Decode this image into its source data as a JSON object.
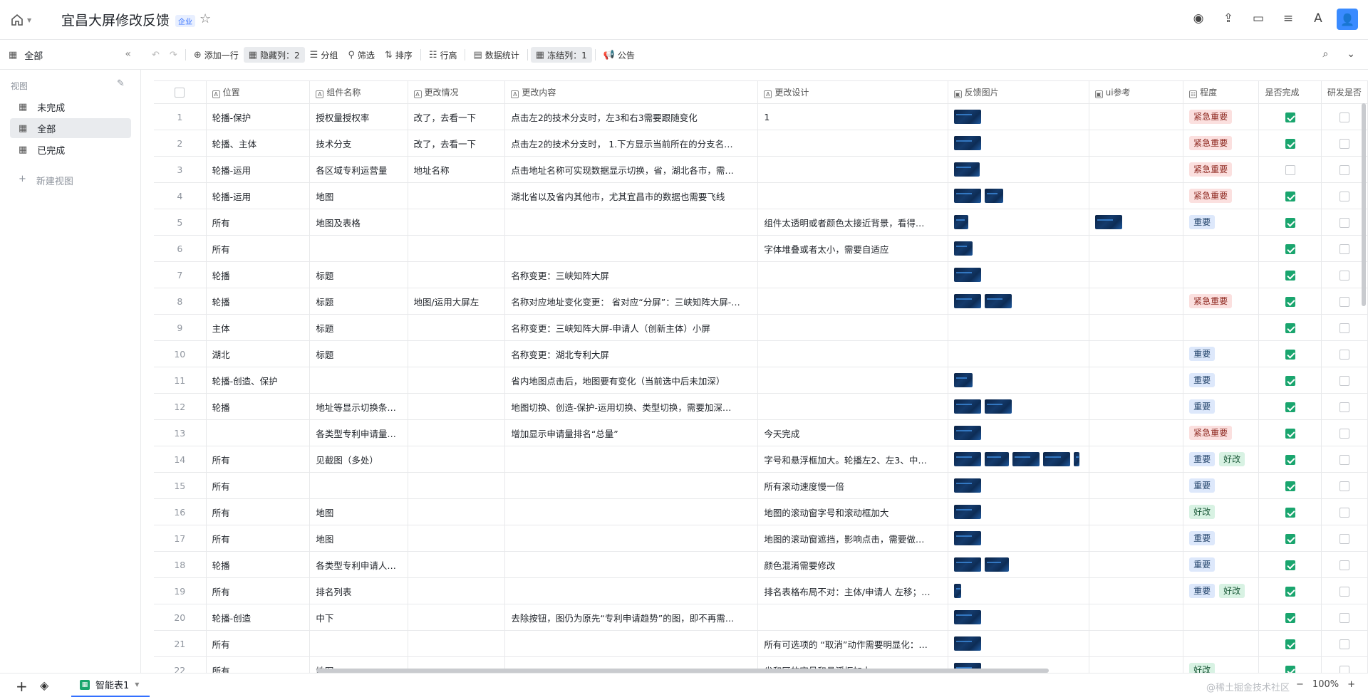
{
  "header": {
    "title": "宜昌大屏修改反馈",
    "badge": "企业"
  },
  "toolbar": {
    "view_name": "全部",
    "add_row": "添加一行",
    "hidden_cols": "隐藏列：2",
    "group": "分组",
    "filter": "筛选",
    "sort": "排序",
    "row_height": "行高",
    "stats": "数据统计",
    "frozen_cols": "冻结列：1",
    "notice": "公告"
  },
  "sidebar": {
    "heading": "视图",
    "items": [
      {
        "label": "未完成"
      },
      {
        "label": "全部"
      },
      {
        "label": "已完成"
      }
    ],
    "new_view": "新建视图"
  },
  "table": {
    "columns": [
      "位置",
      "组件名称",
      "更改情况",
      "更改内容",
      "更改设计",
      "反馈图片",
      "ui参考",
      "程度",
      "是否完成",
      "研发是否"
    ],
    "rows": [
      {
        "n": "1",
        "pos": "轮播-保护",
        "comp": "授权量授权率",
        "status": "改了，去看一下",
        "content": "点击左2的技术分支时，左3和右3需要跟随变化",
        "design": "1",
        "imgs": [
          38
        ],
        "ui": [],
        "tags": [
          "urgent:紧急重要"
        ],
        "done": true
      },
      {
        "n": "2",
        "pos": "轮播、主体",
        "comp": "技术分支",
        "status": "改了，去看一下",
        "content": "点击左2的技术分支时， 1.下方显示当前所在的分支名…",
        "design": "",
        "imgs": [
          38
        ],
        "ui": [],
        "tags": [
          "urgent:紧急重要"
        ],
        "done": true
      },
      {
        "n": "3",
        "pos": "轮播-运用",
        "comp": "各区域专利运营量",
        "status": "地址名称",
        "content": "点击地址名称可实现数据显示切换，省，湖北各市，需…",
        "design": "",
        "imgs": [
          36
        ],
        "ui": [],
        "tags": [
          "urgent:紧急重要"
        ],
        "done": false
      },
      {
        "n": "4",
        "pos": "轮播-运用",
        "comp": "地图",
        "status": "",
        "content": "湖北省以及省内其他市，尤其宜昌市的数据也需要飞线",
        "design": "",
        "imgs": [
          38,
          26
        ],
        "ui": [],
        "tags": [
          "urgent:紧急重要"
        ],
        "done": true
      },
      {
        "n": "5",
        "pos": "所有",
        "comp": "地图及表格",
        "status": "",
        "content": "",
        "design": "组件太透明或者颜色太接近背景，看得…",
        "imgs": [
          20
        ],
        "ui": [
          38
        ],
        "tags": [
          "imp:重要"
        ],
        "done": true
      },
      {
        "n": "6",
        "pos": "所有",
        "comp": "",
        "status": "",
        "content": "",
        "design": "字体堆叠或者太小，需要自适应",
        "imgs": [
          26
        ],
        "ui": [],
        "tags": [],
        "done": true
      },
      {
        "n": "7",
        "pos": "轮播",
        "comp": "标题",
        "status": "",
        "content": "名称变更：三峡知阵大屏",
        "design": "",
        "imgs": [
          38
        ],
        "ui": [],
        "tags": [],
        "done": true
      },
      {
        "n": "8",
        "pos": "轮播",
        "comp": "标题",
        "status": "地图/运用大屏左",
        "content": "名称对应地址变化变更： 省对应“分屏”：三峡知阵大屏-…",
        "design": "",
        "imgs": [
          38,
          38
        ],
        "ui": [],
        "tags": [
          "urgent:紧急重要"
        ],
        "done": true
      },
      {
        "n": "9",
        "pos": "主体",
        "comp": "标题",
        "status": "",
        "content": "名称变更：三峡知阵大屏-申请人（创新主体）小屏",
        "design": "",
        "imgs": [],
        "ui": [],
        "tags": [],
        "done": true
      },
      {
        "n": "10",
        "pos": "湖北",
        "comp": "标题",
        "status": "",
        "content": "名称变更：湖北专利大屏",
        "design": "",
        "imgs": [],
        "ui": [],
        "tags": [
          "imp:重要"
        ],
        "done": true
      },
      {
        "n": "11",
        "pos": "轮播-创造、保护",
        "comp": "",
        "status": "",
        "content": "省内地图点击后，地图要有变化（当前选中后未加深）",
        "design": "",
        "imgs": [
          26
        ],
        "ui": [],
        "tags": [
          "imp:重要"
        ],
        "done": true
      },
      {
        "n": "12",
        "pos": "轮播",
        "comp": "地址等显示切换条…",
        "status": "",
        "content": "地图切换、创造-保护-运用切换、类型切换，需要加深…",
        "design": "",
        "imgs": [
          38,
          38
        ],
        "ui": [],
        "tags": [
          "imp:重要"
        ],
        "done": true
      },
      {
        "n": "13",
        "pos": "",
        "comp": "各类型专利申请量…",
        "status": "",
        "content": "增加显示申请量排名“总量”",
        "design": "今天完成",
        "imgs": [
          38
        ],
        "ui": [],
        "tags": [
          "urgent:紧急重要"
        ],
        "done": true
      },
      {
        "n": "14",
        "pos": "所有",
        "comp": "见截图（多处）",
        "status": "",
        "content": "",
        "design": "字号和悬浮框加大。轮播左2、左3、中…",
        "imgs": [
          38,
          34,
          38,
          38,
          8
        ],
        "ui": [],
        "tags": [
          "imp:重要",
          "good:好改"
        ],
        "done": true
      },
      {
        "n": "15",
        "pos": "所有",
        "comp": "",
        "status": "",
        "content": "",
        "design": "所有滚动速度慢一倍",
        "imgs": [
          38
        ],
        "ui": [],
        "tags": [
          "imp:重要"
        ],
        "done": true
      },
      {
        "n": "16",
        "pos": "所有",
        "comp": "地图",
        "status": "",
        "content": "",
        "design": "地图的滚动窗字号和滚动框加大",
        "imgs": [
          38
        ],
        "ui": [],
        "tags": [
          "good:好改"
        ],
        "done": true
      },
      {
        "n": "17",
        "pos": "所有",
        "comp": "地图",
        "status": "",
        "content": "",
        "design": "地图的滚动窗遮挡，影响点击，需要做…",
        "imgs": [
          38
        ],
        "ui": [],
        "tags": [
          "imp:重要"
        ],
        "done": true
      },
      {
        "n": "18",
        "pos": "轮播",
        "comp": "各类型专利申请人…",
        "status": "",
        "content": "",
        "design": "颜色混淆需要修改",
        "imgs": [
          38,
          34
        ],
        "ui": [],
        "tags": [
          "imp:重要"
        ],
        "done": true
      },
      {
        "n": "19",
        "pos": "所有",
        "comp": "排名列表",
        "status": "",
        "content": "",
        "design": "排名表格布局不对：主体/申请人 左移；…",
        "imgs": [
          10
        ],
        "ui": [],
        "tags": [
          "imp:重要",
          "good:好改"
        ],
        "done": true
      },
      {
        "n": "20",
        "pos": "轮播-创造",
        "comp": "中下",
        "status": "",
        "content": "去除按钮，图仍为原先“专利申请趋势”的图，即不再需…",
        "design": "",
        "imgs": [
          38
        ],
        "ui": [],
        "tags": [],
        "done": true
      },
      {
        "n": "21",
        "pos": "所有",
        "comp": "",
        "status": "",
        "content": "",
        "design": "所有可选项的 “取消”动作需要明显化：…",
        "imgs": [
          38
        ],
        "ui": [],
        "tags": [],
        "done": true
      },
      {
        "n": "22",
        "pos": "所有",
        "comp": "地图",
        "status": "",
        "content": "",
        "design": "省和区的字号和悬浮框加大",
        "imgs": [
          38
        ],
        "ui": [],
        "tags": [
          "good:好改"
        ],
        "done": true
      }
    ]
  },
  "bottom": {
    "sheet_name": "智能表1",
    "zoom": "100%",
    "watermark": "@稀土掘金技术社区"
  }
}
